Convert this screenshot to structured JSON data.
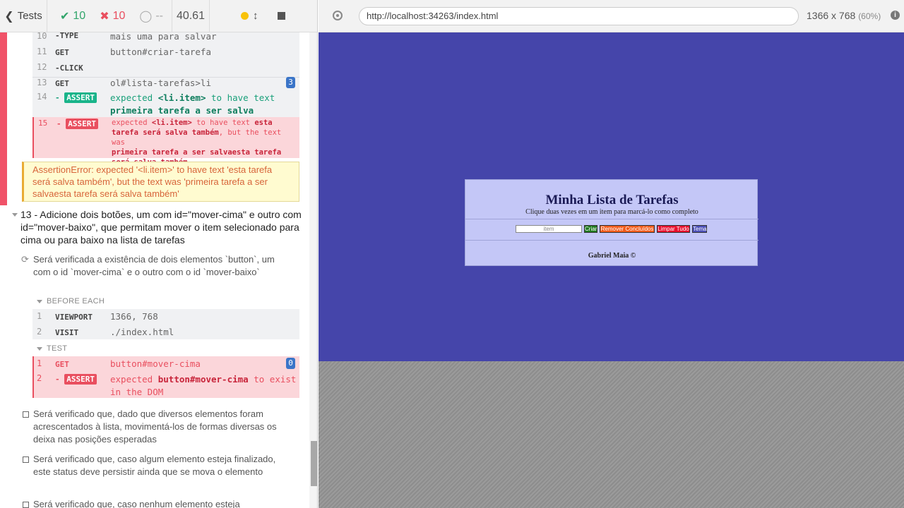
{
  "topbar": {
    "tests_label": "Tests",
    "passed": "10",
    "failed": "10",
    "pending": "--",
    "duration": "40.61"
  },
  "commands_top": [
    {
      "num": "10",
      "name": "-TYPE",
      "msg": "mais uma para salvar"
    },
    {
      "num": "11",
      "name": "GET",
      "msg": "button#criar-tarefa"
    },
    {
      "num": "12",
      "name": "-CLICK",
      "msg": ""
    },
    {
      "num": "13",
      "name": "GET",
      "msg": "ol#lista-tarefas>li",
      "count": "3"
    }
  ],
  "assert14": {
    "num": "14",
    "badge": "ASSERT",
    "msg_pre": "expected",
    "msg_el": "<li.item>",
    "msg_mid": "to have text",
    "msg_val": "primeira tarefa a ser salva"
  },
  "assert15": {
    "num": "15",
    "badge": "ASSERT",
    "line1_pre": "expected",
    "line1_el": "<li.item>",
    "line1_mid": "to have text",
    "line1_val": "esta",
    "line2_val": "tarefa será salva também",
    "line2_rest": ", but the text was",
    "line3": "primeira tarefa a ser salvaesta tarefa",
    "line4": "será salva também"
  },
  "error_message": "AssertionError: expected '<li.item>' to have text 'esta tarefa será salva também', but the text was 'primeira tarefa a ser salvaesta tarefa será salva também'",
  "suite13": {
    "title": "13 - Adicione dois botões, um com id=\"mover-cima\" e outro com id=\"mover-baixo\", que permitam mover o item selecionado para cima ou para baixo na lista de tarefas",
    "test1": "Será verificada a existência de dois elementos `button`, um com o id `mover-cima` e o outro com o id `mover-baixo`",
    "before_each": "BEFORE EACH",
    "before_cmds": [
      {
        "num": "1",
        "name": "VIEWPORT",
        "msg": "1366, 768"
      },
      {
        "num": "2",
        "name": "VISIT",
        "msg": "./index.html"
      }
    ],
    "test_label": "TEST",
    "test_cmd1": {
      "num": "1",
      "name": "GET",
      "msg": "button#mover-cima",
      "count": "0"
    },
    "test_cmd2": {
      "num": "2",
      "badge": "ASSERT",
      "msg_pre": "expected",
      "msg_el": "button#mover-cima",
      "msg_mid": "to exist",
      "msg_tail": "in the DOM"
    },
    "test2": "Será verificado que, dado que diversos elementos foram acrescentados à lista, movimentá-los de formas diversas os deixa nas posições esperadas",
    "test3": "Será verificado que, caso algum elemento esteja finalizado, este status deve persistir ainda que se mova o elemento",
    "test4": "Será verificado que, caso nenhum elemento esteja"
  },
  "browser": {
    "url": "http://localhost:34263/index.html",
    "viewport": "1366 x 768",
    "scale": "(60%)"
  },
  "app": {
    "title": "Minha Lista de Tarefas",
    "subtitle": "Clique duas vezes em um item para marcá-lo como completo",
    "input_placeholder": "item",
    "buttons": [
      {
        "label": "Criar",
        "color": "#1f7a1f"
      },
      {
        "label": "Remover Concluídos",
        "color": "#f25c1c"
      },
      {
        "label": "Limpar Tudo",
        "color": "#e8102e"
      },
      {
        "label": "Tema",
        "color": "#4c50b8"
      }
    ],
    "footer": "Gabriel Maia ©"
  }
}
